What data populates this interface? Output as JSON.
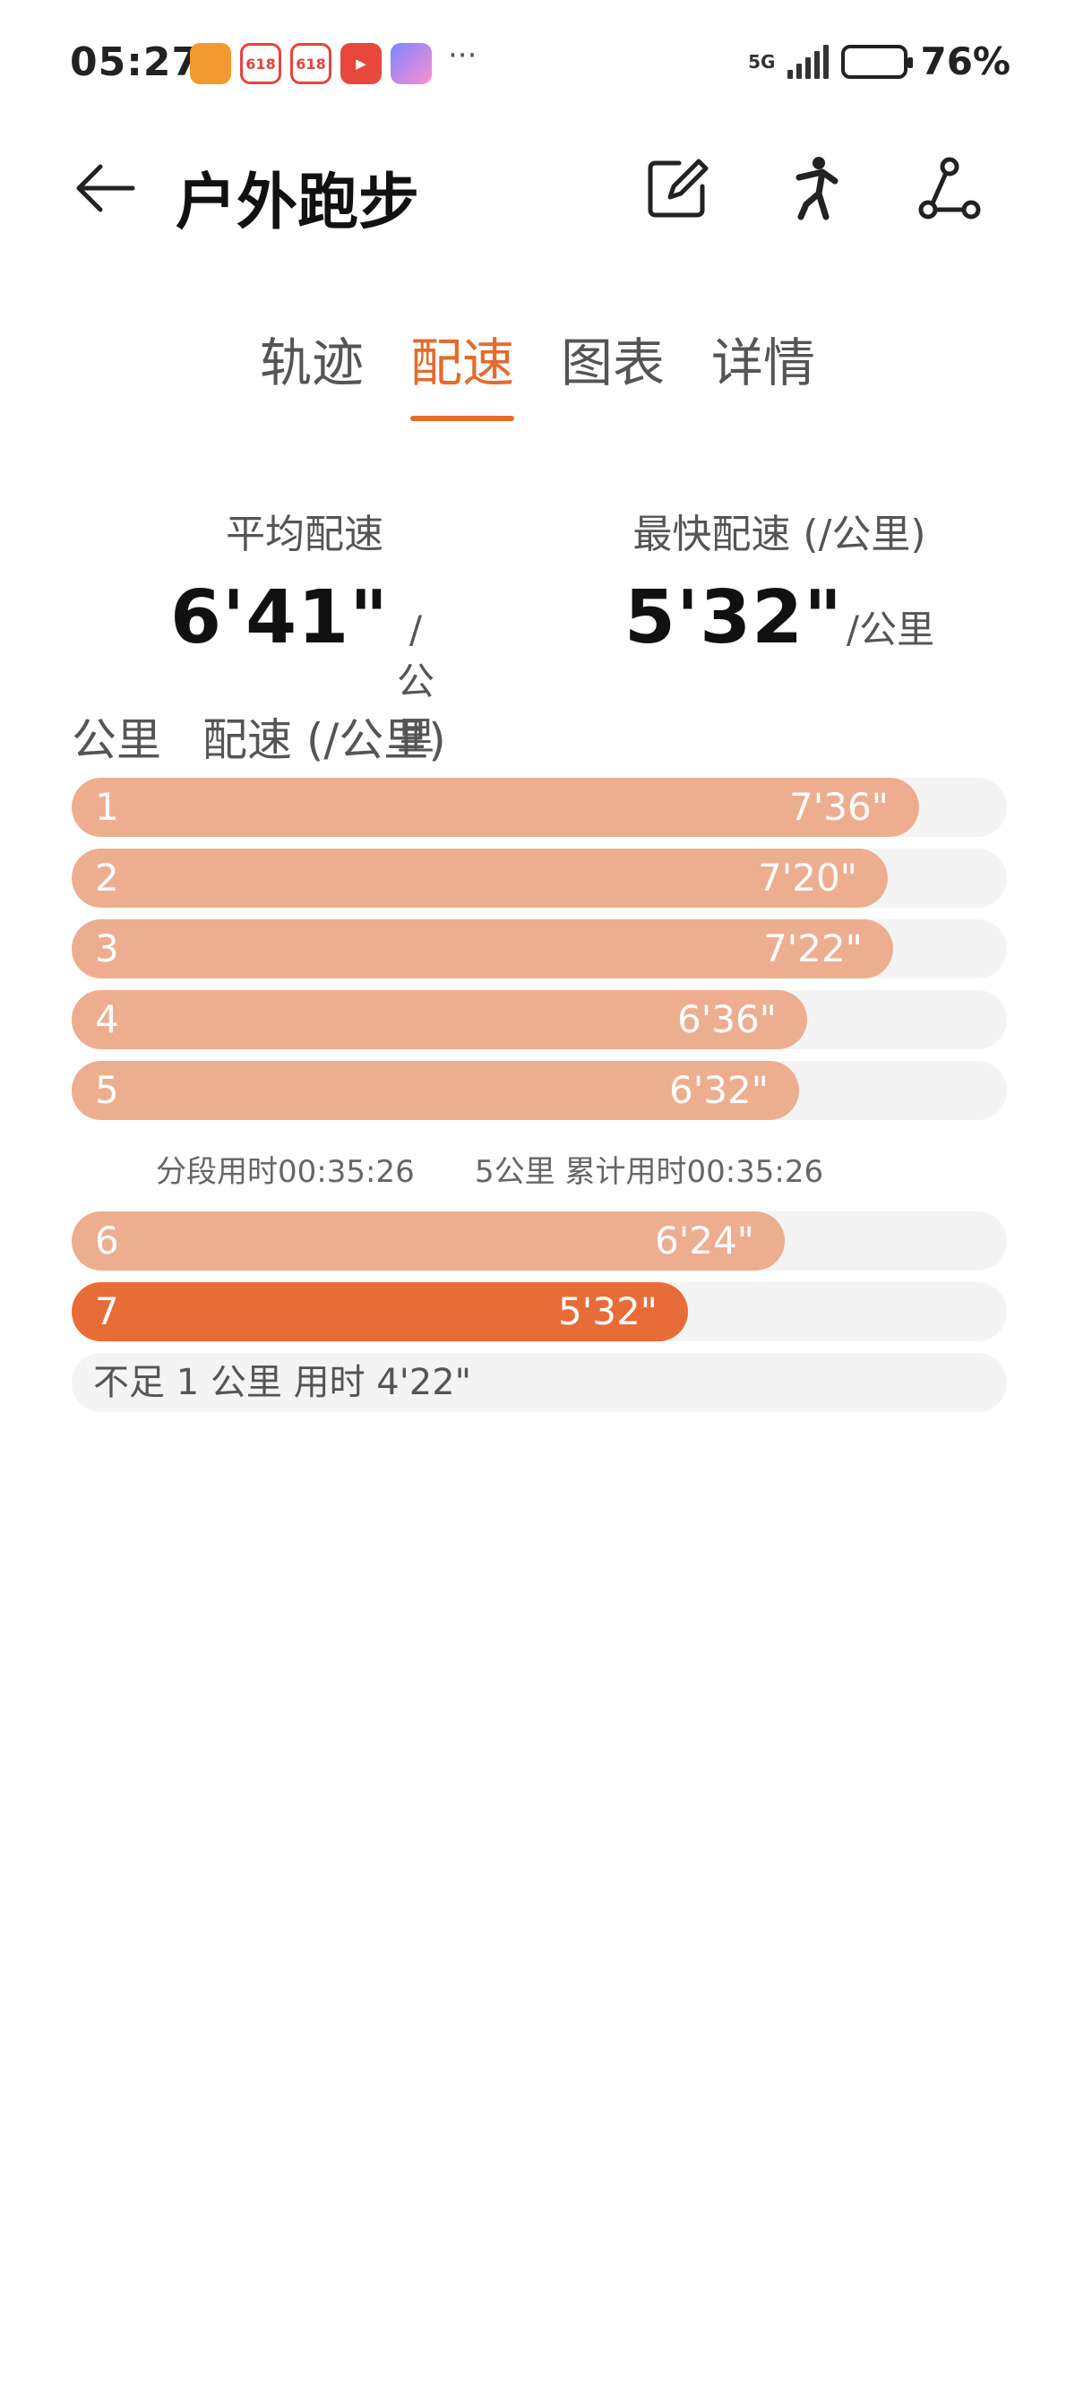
{
  "status_bar": {
    "time": "05:27",
    "app_icons": [
      {
        "name": "orange-app-icon",
        "label": ""
      },
      {
        "name": "618-app-icon",
        "label": "618"
      },
      {
        "name": "618-app-icon",
        "label": "618"
      },
      {
        "name": "video-app-icon",
        "label": "▶"
      },
      {
        "name": "chat-app-icon",
        "label": ""
      }
    ],
    "more": "···",
    "network": "5G",
    "battery_percent": "76%",
    "battery_level": 0.76
  },
  "header": {
    "title": "户外跑步",
    "back_icon": "arrow-left-icon",
    "actions": [
      "edit-icon",
      "runner-icon",
      "share-route-icon"
    ]
  },
  "tabs": [
    {
      "label": "轨迹",
      "active": false
    },
    {
      "label": "配速",
      "active": true
    },
    {
      "label": "图表",
      "active": false
    },
    {
      "label": "详情",
      "active": false
    }
  ],
  "stats": {
    "avg": {
      "label": "平均配速",
      "value": "6'41\"",
      "unit": "/公里"
    },
    "fastest": {
      "label": "最快配速 (/公里)",
      "value": "5'32\"",
      "unit": "/公里"
    }
  },
  "table_header": {
    "col_km": "公里",
    "col_pace": "配速 (/公里)"
  },
  "splits": [
    {
      "km": "1",
      "pace": "7'36\"",
      "fill": 0.906,
      "best": false
    },
    {
      "km": "2",
      "pace": "7'20\"",
      "fill": 0.873,
      "best": false
    },
    {
      "km": "3",
      "pace": "7'22\"",
      "fill": 0.878,
      "best": false
    },
    {
      "km": "4",
      "pace": "6'36\"",
      "fill": 0.786,
      "best": false
    },
    {
      "km": "5",
      "pace": "6'32\"",
      "fill": 0.778,
      "best": false
    },
    {
      "km": "6",
      "pace": "6'24\"",
      "fill": 0.762,
      "best": false
    },
    {
      "km": "7",
      "pace": "5'32\"",
      "fill": 0.659,
      "best": true
    }
  ],
  "summary": {
    "segment": "分段用时00:35:26",
    "cumulative": "5公里 累计用时00:35:26"
  },
  "remainder": "不足 1 公里 用时 4'22\"",
  "colors": {
    "accent": "#e66a2c",
    "bar": "#edae8f",
    "bar_best": "#e86c38",
    "track": "#f4f4f4"
  }
}
